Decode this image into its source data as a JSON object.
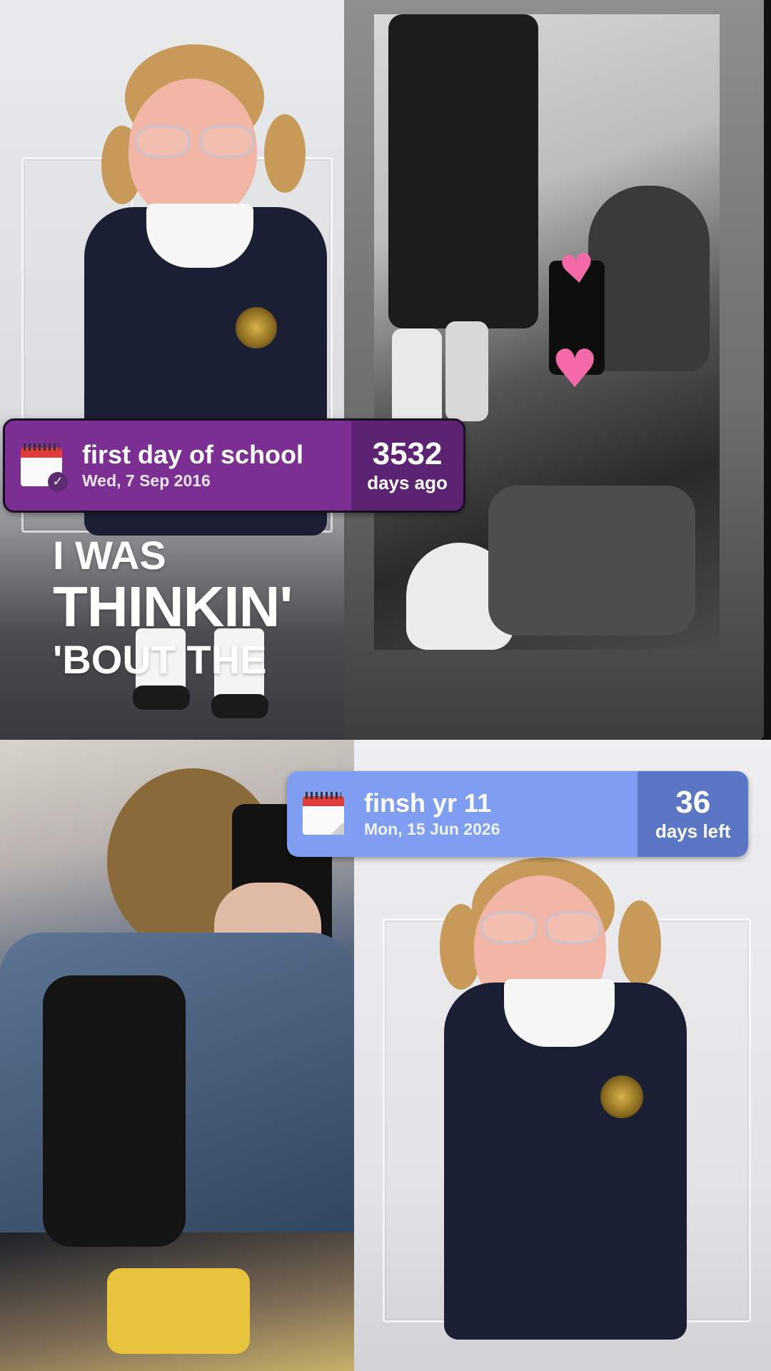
{
  "widgets": {
    "past": {
      "title": "first day of school",
      "date": "Wed, 7 Sep 2016",
      "count": "3532",
      "unit": "days ago",
      "color": "#7b2f92",
      "accent": "#5c2372",
      "icon": "calendar-check-icon"
    },
    "future": {
      "title": "finsh yr 11",
      "date": "Mon, 15 Jun 2026",
      "count": "36",
      "unit": "days left",
      "color": "#7f9ef2",
      "accent": "#5a76c4",
      "icon": "calendar-icon"
    }
  },
  "caption": {
    "line1": "I WAS",
    "line2": "THINKIN'",
    "line3": "'BOUT THE"
  },
  "stickers": {
    "heart_large": "♥",
    "heart_small": "♥"
  }
}
